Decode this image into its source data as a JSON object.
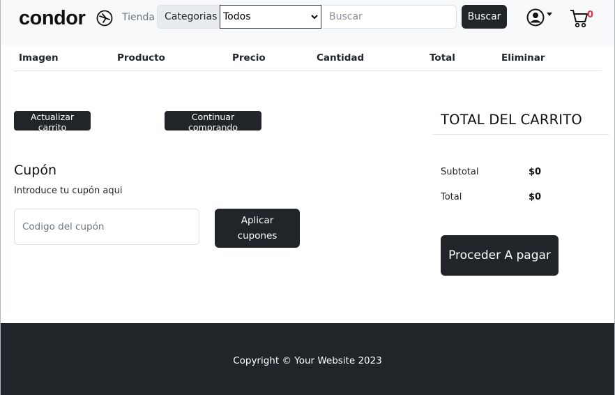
{
  "navbar": {
    "brand": "condor",
    "tienda_link": "Tienda",
    "categories_label": "Categorias",
    "categories_selected": "Todos",
    "search_placeholder": "Buscar",
    "search_button": "Buscar",
    "cart_count": "0"
  },
  "table": {
    "headers": [
      "Imagen",
      "Producto",
      "Precio",
      "Cantidad",
      "Total",
      "Eliminar"
    ]
  },
  "actions": {
    "update_cart": "Actualizar carrito",
    "continue_shopping": "Continuar comprando"
  },
  "coupon": {
    "title": "Cupón",
    "description": "Introduce tu cupón aqui",
    "placeholder": "Codigo del cupón",
    "apply_button": "Aplicar cupones"
  },
  "totals": {
    "title": "TOTAL DEL CARRITO",
    "subtotal_label": "Subtotal",
    "subtotal_value": "$0",
    "total_label": "Total",
    "total_value": "$0",
    "checkout_button": "Proceder A pagar"
  },
  "footer": {
    "copyright": "Copyright © Your Website 2023"
  },
  "colors": {
    "dark": "#212529",
    "navbar_bg": "#f8f9fa",
    "cart_badge": "#dc3545"
  }
}
